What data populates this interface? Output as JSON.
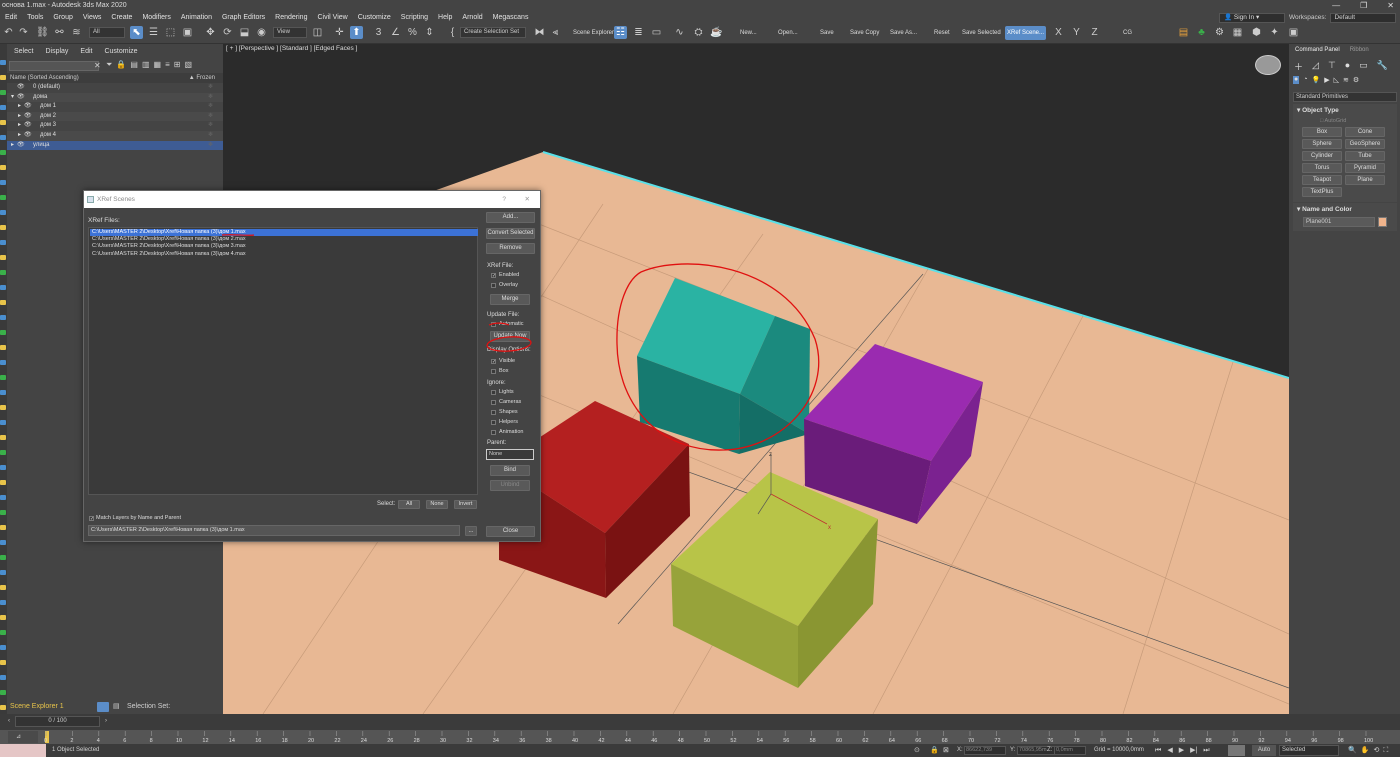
{
  "title": "основа 1.max - Autodesk 3ds Max 2020",
  "menus": [
    "Edit",
    "Tools",
    "Group",
    "Views",
    "Create",
    "Modifiers",
    "Animation",
    "Graph Editors",
    "Rendering",
    "Civil View",
    "Customize",
    "Scripting",
    "Help",
    "Arnold",
    "Megascans"
  ],
  "signin": "Sign In",
  "workspaces_label": "Workspaces:",
  "workspaces_value": "Default",
  "toolbar": {
    "filter_all": "All",
    "view": "View",
    "create_selection_set": "Create Selection Set",
    "scene_explorer": "Scene Explorer",
    "buttons": [
      "New...",
      "Open...",
      "Save",
      "Save Copy",
      "Save As...",
      "Reset",
      "Save Selected",
      "XRef Scene..."
    ],
    "axes": [
      "X",
      "Y",
      "Z"
    ],
    "cg": "CG"
  },
  "scene_explorer": {
    "tabs": [
      "Select",
      "Display",
      "Edit",
      "Customize"
    ],
    "header_name": "Name (Sorted Ascending)",
    "header_frozen": "▲ Frozen",
    "rows": [
      "0 (default)",
      "дома",
      "дом 1",
      "дом 2",
      "дом 3",
      "дом 4",
      "улица"
    ],
    "bottom_label": "Scene Explorer 1",
    "selection_set": "Selection Set:",
    "frame_counter": "0 / 100"
  },
  "viewport": {
    "label": "[ + ] [Perspective ] [Standard ] [Edged Faces ]",
    "axis_z": "z",
    "axis_x": "x"
  },
  "command_panel": {
    "tabs": [
      "Command Panel",
      "Ribbon"
    ],
    "category": "Standard Primitives",
    "object_type_title": "Object Type",
    "autogrid": "AutoGrid",
    "primitives": [
      "Box",
      "Cone",
      "Sphere",
      "GeoSphere",
      "Cylinder",
      "Tube",
      "Torus",
      "Pyramid",
      "Teapot",
      "Plane",
      "TextPlus"
    ],
    "name_color_title": "Name and Color",
    "object_name": "Plane001",
    "object_color": "#f0b48c"
  },
  "dialog": {
    "title": "XRef Scenes",
    "help": "?",
    "close": "✕",
    "xref_files_label": "XRef Files:",
    "files": [
      "C:\\Users\\MASTER 2\\Desktop\\Xref\\Новая папка (3)\\дом 1.max",
      "C:\\Users\\MASTER 2\\Desktop\\Xref\\Новая папка (3)\\дом 2.max",
      "C:\\Users\\MASTER 2\\Desktop\\Xref\\Новая папка (3)\\дом 3.max",
      "C:\\Users\\MASTER 2\\Desktop\\Xref\\Новая папка (3)\\дом 4.max"
    ],
    "add": "Add...",
    "convert_selected": "Convert Selected",
    "remove": "Remove",
    "xref_file_label": "XRef File:",
    "enabled": "Enabled",
    "overlay": "Overlay",
    "merge": "Merge",
    "update_file_label": "Update File:",
    "automatic": "Automatic",
    "update_now": "Update Now",
    "display_options_label": "Display Options:",
    "visible": "Visible",
    "box": "Box",
    "ignore_label": "Ignore:",
    "ignore_items": [
      "Lights",
      "Cameras",
      "Shapes",
      "Helpers",
      "Animation"
    ],
    "parent_label": "Parent:",
    "parent_value": "None",
    "bind": "Bind",
    "unbind": "Unbind",
    "select_label": "Select:",
    "select_all": "All",
    "select_none": "None",
    "select_invert": "Invert",
    "match_layers": "Match Layers by Name and Parent",
    "path_value": "C:\\Users\\MASTER 2\\Desktop\\Xref\\Новая папка (3)\\дом 1.max",
    "browse": "...",
    "close_btn": "Close"
  },
  "status": {
    "selected": "1 Object Selected",
    "x_label": "X:",
    "x_value": "86622,739",
    "y_label": "Y:",
    "y_value": "70865,95m",
    "z_label": "Z:",
    "z_value": "0,0mm",
    "grid": "Grid = 10000,0mm",
    "auto": "Auto",
    "selected_dd": "Selected",
    "ticks": [
      0,
      2,
      4,
      6,
      8,
      10,
      12,
      14,
      16,
      18,
      20,
      22,
      24,
      26,
      28,
      30,
      32,
      34,
      36,
      38,
      40,
      42,
      44,
      46,
      48,
      50,
      52,
      54,
      56,
      58,
      60,
      62,
      64,
      66,
      68,
      70,
      72,
      74,
      76,
      78,
      80,
      82,
      84,
      86,
      88,
      90,
      92,
      94,
      96,
      98,
      100
    ]
  },
  "colors": {
    "selection_blue": "#3c72d6",
    "xref_button": "#5b8dc8",
    "ground": "#e8b894",
    "house_teal": "#2ab3a3",
    "box_red": "#b42020",
    "box_purple": "#9a2bb0",
    "box_yellow": "#b8c448",
    "annotation_red": "#e01010"
  }
}
